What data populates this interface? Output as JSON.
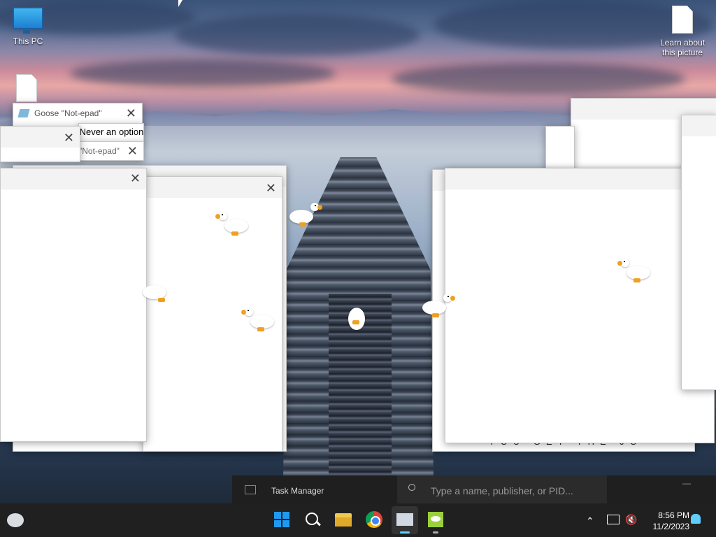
{
  "desktop": {
    "icons": [
      {
        "label": "This PC"
      },
      {
        "label": "Learn about this picture"
      }
    ]
  },
  "windows": {
    "goose_notepad_title": "Goose \"Not-epad\"",
    "goose_notepad_title2": "\"Not-epad\"",
    "option_text": "\"Never an option\"",
    "dialog_text": "YOU GET THE JOKE"
  },
  "task_manager": {
    "title": "Task Manager",
    "search_placeholder": "Type a name, publisher, or PID..."
  },
  "taskbar": {
    "time": "8:56 PM",
    "date": "11/2/2023"
  },
  "colors": {
    "taskbar_bg": "#202020",
    "accent": "#0078d4"
  }
}
